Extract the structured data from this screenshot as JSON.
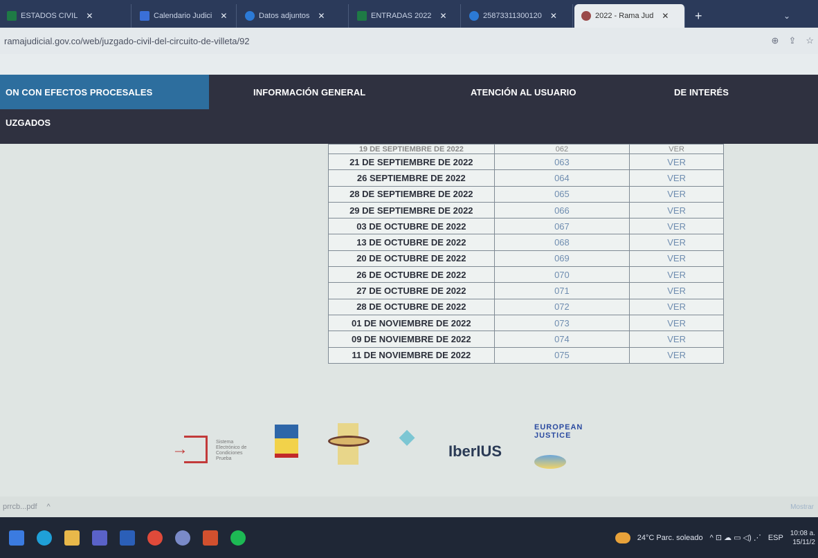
{
  "browser": {
    "tabs": [
      {
        "label": "ESTADOS CIVIL",
        "color": "#1e7a45"
      },
      {
        "label": "Calendario Judici",
        "color": "#3a6fd8"
      },
      {
        "label": "Datos adjuntos",
        "color": "#2c7ad6"
      },
      {
        "label": "ENTRADAS 2022",
        "color": "#1e7a45"
      },
      {
        "label": "25873311300120",
        "color": "#2c7ad6"
      },
      {
        "label": "2022 - Rama Jud",
        "color": "#9a4a4a"
      }
    ],
    "close_glyph": "✕",
    "newtab_glyph": "+",
    "chevron_glyph": "⌄",
    "url": "ramajudicial.gov.co/web/juzgado-civil-del-circuito-de-villeta/92",
    "address_icons": [
      "zoom-icon",
      "share-icon",
      "star-icon"
    ]
  },
  "nav": {
    "items": [
      "ON CON EFECTOS PROCESALES",
      "INFORMACIÓN GENERAL",
      "ATENCIÓN AL USUARIO",
      "DE INTERÉS"
    ],
    "row2": "UZGADOS"
  },
  "table": {
    "partial_row": {
      "fecha": "19 DE SEPTIEMBRE DE 2022",
      "num": "062",
      "ver": "VER"
    },
    "rows": [
      {
        "fecha": "21 DE SEPTIEMBRE DE 2022",
        "num": "063",
        "ver": "VER"
      },
      {
        "fecha": "26 SEPTIEMBRE DE 2022",
        "num": "064",
        "ver": "VER"
      },
      {
        "fecha": "28 DE SEPTIEMBRE DE 2022",
        "num": "065",
        "ver": "VER"
      },
      {
        "fecha": "29 DE SEPTIEMBRE DE 2022",
        "num": "066",
        "ver": "VER"
      },
      {
        "fecha": "03 DE OCTUBRE DE 2022",
        "num": "067",
        "ver": "VER"
      },
      {
        "fecha": "13 DE OCTUBRE DE 2022",
        "num": "068",
        "ver": "VER"
      },
      {
        "fecha": "20 DE OCTUBRE DE 2022",
        "num": "069",
        "ver": "VER"
      },
      {
        "fecha": "26 DE OCTUBRE DE 2022",
        "num": "070",
        "ver": "VER"
      },
      {
        "fecha": "27 DE OCTUBRE DE 2022",
        "num": "071",
        "ver": "VER"
      },
      {
        "fecha": "28 DE OCTUBRE DE 2022",
        "num": "072",
        "ver": "VER"
      },
      {
        "fecha": "01 DE NOVIEMBRE DE 2022",
        "num": "073",
        "ver": "VER"
      },
      {
        "fecha": "09 DE NOVIEMBRE DE 2022",
        "num": "074",
        "ver": "VER"
      },
      {
        "fecha": "11 DE NOVIEMBRE DE 2022",
        "num": "075",
        "ver": "VER"
      }
    ]
  },
  "logos": {
    "lg1_text": "Sistema Electrónico de Condiciones Prueba",
    "lg5_text": "IberIUS",
    "lg6_text": "EUROPEAN JUSTICE"
  },
  "downloads": {
    "file": "prrcb...pdf",
    "expand_glyph": "^",
    "show_all": "Mostrar"
  },
  "taskbar": {
    "apps": [
      {
        "name": "windows-start-icon",
        "color": "#3b7be0"
      },
      {
        "name": "edge-icon",
        "color": "#1fa0d8"
      },
      {
        "name": "file-explorer-icon",
        "color": "#e8b84a"
      },
      {
        "name": "teams-icon",
        "color": "#5a62c8"
      },
      {
        "name": "word-icon",
        "color": "#2b5fb8"
      },
      {
        "name": "chrome-icon",
        "color": "#e04a3a"
      },
      {
        "name": "app-icon",
        "color": "#7a8ac8"
      },
      {
        "name": "powerpoint-icon",
        "color": "#d2502e"
      },
      {
        "name": "spotify-icon",
        "color": "#1db954"
      }
    ],
    "weather": "24°C  Parc. soleado",
    "tray_glyphs": "^  ⊡  ☁  ▭  ◁)  ⋰",
    "lang": "ESP",
    "time": "10:08 a.",
    "date": "15/11/2"
  }
}
